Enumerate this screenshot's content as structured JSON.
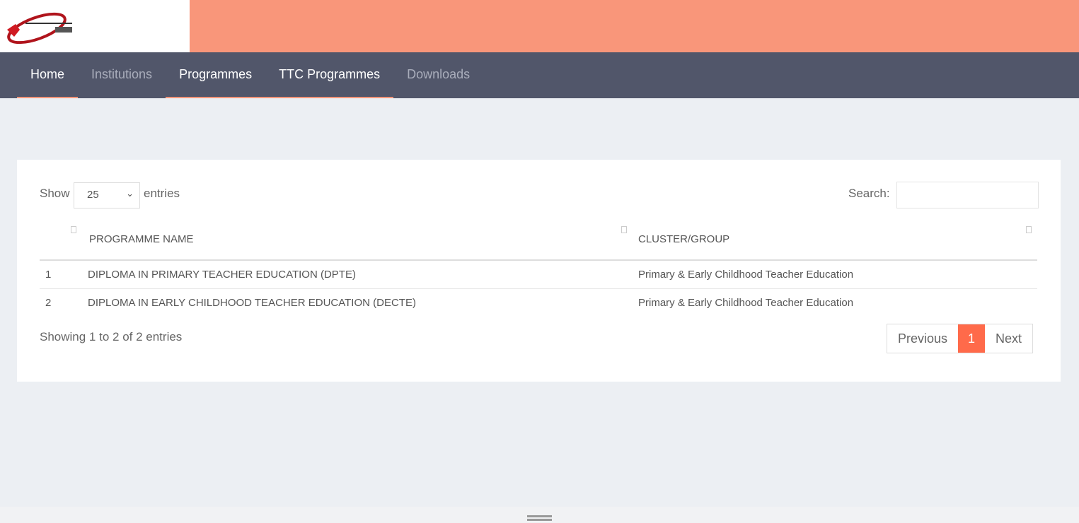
{
  "nav": {
    "items": [
      {
        "label": "Home",
        "active": true
      },
      {
        "label": "Institutions",
        "active": false
      },
      {
        "label": "Programmes",
        "active": true
      },
      {
        "label": "TTC Programmes",
        "active": true
      },
      {
        "label": "Downloads",
        "active": false
      }
    ]
  },
  "table_controls": {
    "show_label": "Show",
    "entries_value": "25",
    "entries_label": "entries",
    "search_label": "Search:",
    "search_value": ""
  },
  "table": {
    "columns": [
      "",
      "PROGRAMME NAME",
      "CLUSTER/GROUP"
    ],
    "rows": [
      [
        "1",
        "DIPLOMA IN PRIMARY TEACHER EDUCATION (DPTE)",
        "Primary & Early Childhood Teacher Education"
      ],
      [
        "2",
        "DIPLOMA IN EARLY CHILDHOOD TEACHER EDUCATION (DECTE)",
        "Primary & Early Childhood Teacher Education"
      ]
    ]
  },
  "footer": {
    "info": "Showing 1 to 2 of 2 entries",
    "previous": "Previous",
    "current_page": "1",
    "next": "Next"
  },
  "colors": {
    "accent": "#ff6a4a",
    "banner": "#f9967a",
    "nav_bg": "#51566a"
  }
}
